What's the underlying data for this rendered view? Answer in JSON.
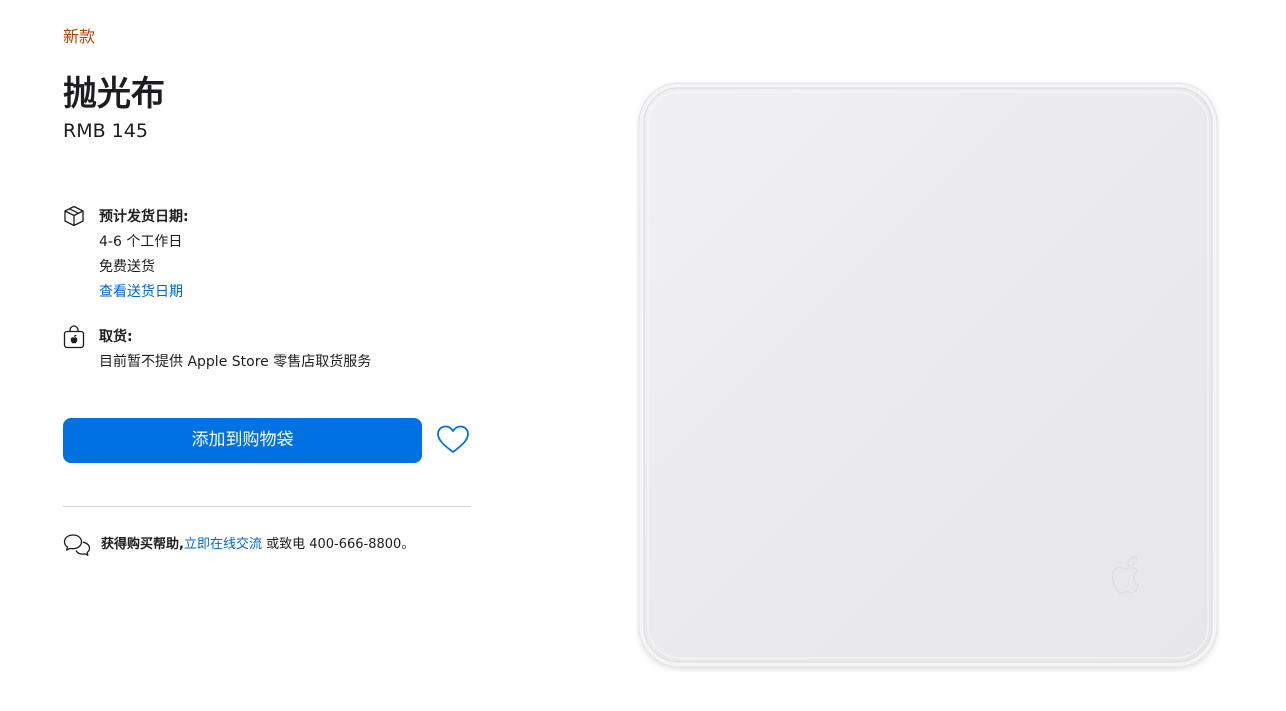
{
  "product": {
    "badge": "新款",
    "name": "抛光布",
    "price": "RMB 145"
  },
  "delivery": {
    "icon": "box-icon",
    "heading": "预计发货日期:",
    "eta": "4-6 个工作日",
    "shipping": "免费送货",
    "link": "查看送货日期"
  },
  "pickup": {
    "icon": "shopping-bag-icon",
    "heading": "取货:",
    "status": "目前暂不提供 Apple Store 零售店取货服务"
  },
  "actions": {
    "add_to_bag": "添加到购物袋",
    "favorite_icon": "heart-icon"
  },
  "help": {
    "icon": "chat-bubbles-icon",
    "lead": "获得购买帮助,",
    "link": "立即在线交流",
    "suffix": " 或致电 400-666-8800。"
  },
  "colors": {
    "accent": "#0071e3",
    "link": "#0066cc",
    "badge": "#b64400",
    "text": "#1d1d1f"
  }
}
